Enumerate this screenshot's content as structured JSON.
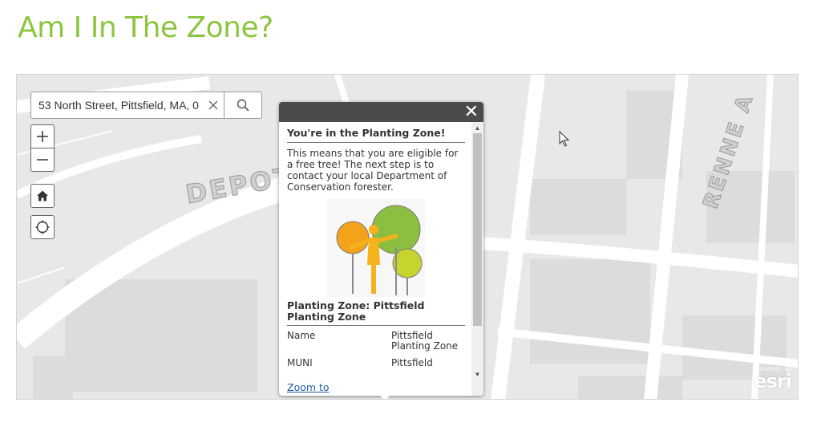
{
  "page": {
    "title": "Am I In The Zone?"
  },
  "map": {
    "labels": {
      "depot": "DEPOT",
      "renne": "RENNE A"
    }
  },
  "search": {
    "value": "53 North Street, Pittsfield, MA, 0",
    "clear_icon": "close-icon",
    "search_icon": "search-icon"
  },
  "controls": {
    "zoom_in": "+",
    "zoom_out": "−",
    "home_icon": "home-icon",
    "locate_icon": "locate-icon"
  },
  "popup": {
    "close": "✕",
    "heading": "You're in the Planting Zone!",
    "description": "This means that you are eligible for a free tree! The next step is to contact your local Department of Conservation forester.",
    "image_icon": "tree-planting-icon",
    "subtitle": "Planting Zone: Pittsfield Planting Zone",
    "attributes": [
      {
        "key": "Name",
        "value": "Pittsfield Planting Zone"
      },
      {
        "key": "MUNI",
        "value": "Pittsfield"
      }
    ],
    "zoom_link": "Zoom to"
  },
  "attribution": {
    "powered_by": "POWERED BY",
    "logo": "esri"
  },
  "colors": {
    "title_green": "#8cc63f",
    "popup_header": "#4b4b4b",
    "map_background": "#e8e8e8"
  }
}
